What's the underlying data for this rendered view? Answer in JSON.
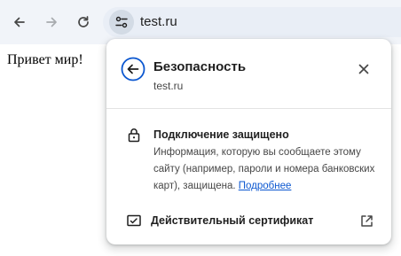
{
  "browser": {
    "url": "test.ru",
    "icons": {
      "back": "arrow-left-icon",
      "forward": "arrow-right-icon",
      "reload": "reload-icon",
      "site_info": "tune-icon"
    }
  },
  "page": {
    "text": "Привет мир!"
  },
  "site_info_popup": {
    "title": "Безопасность",
    "subtitle": "test.ru",
    "connection": {
      "title": "Подключение защищено",
      "description": "Информация, которую вы сообщаете этому сайту (например, пароли и номера банковских карт), защищена.",
      "link_label": "Подробнее"
    },
    "certificate": {
      "label": "Действительный сертификат"
    }
  },
  "colors": {
    "toolbar_bg": "#f1f4f9",
    "accent_blue": "#0b57d0",
    "text_primary": "#1f1f1f"
  }
}
